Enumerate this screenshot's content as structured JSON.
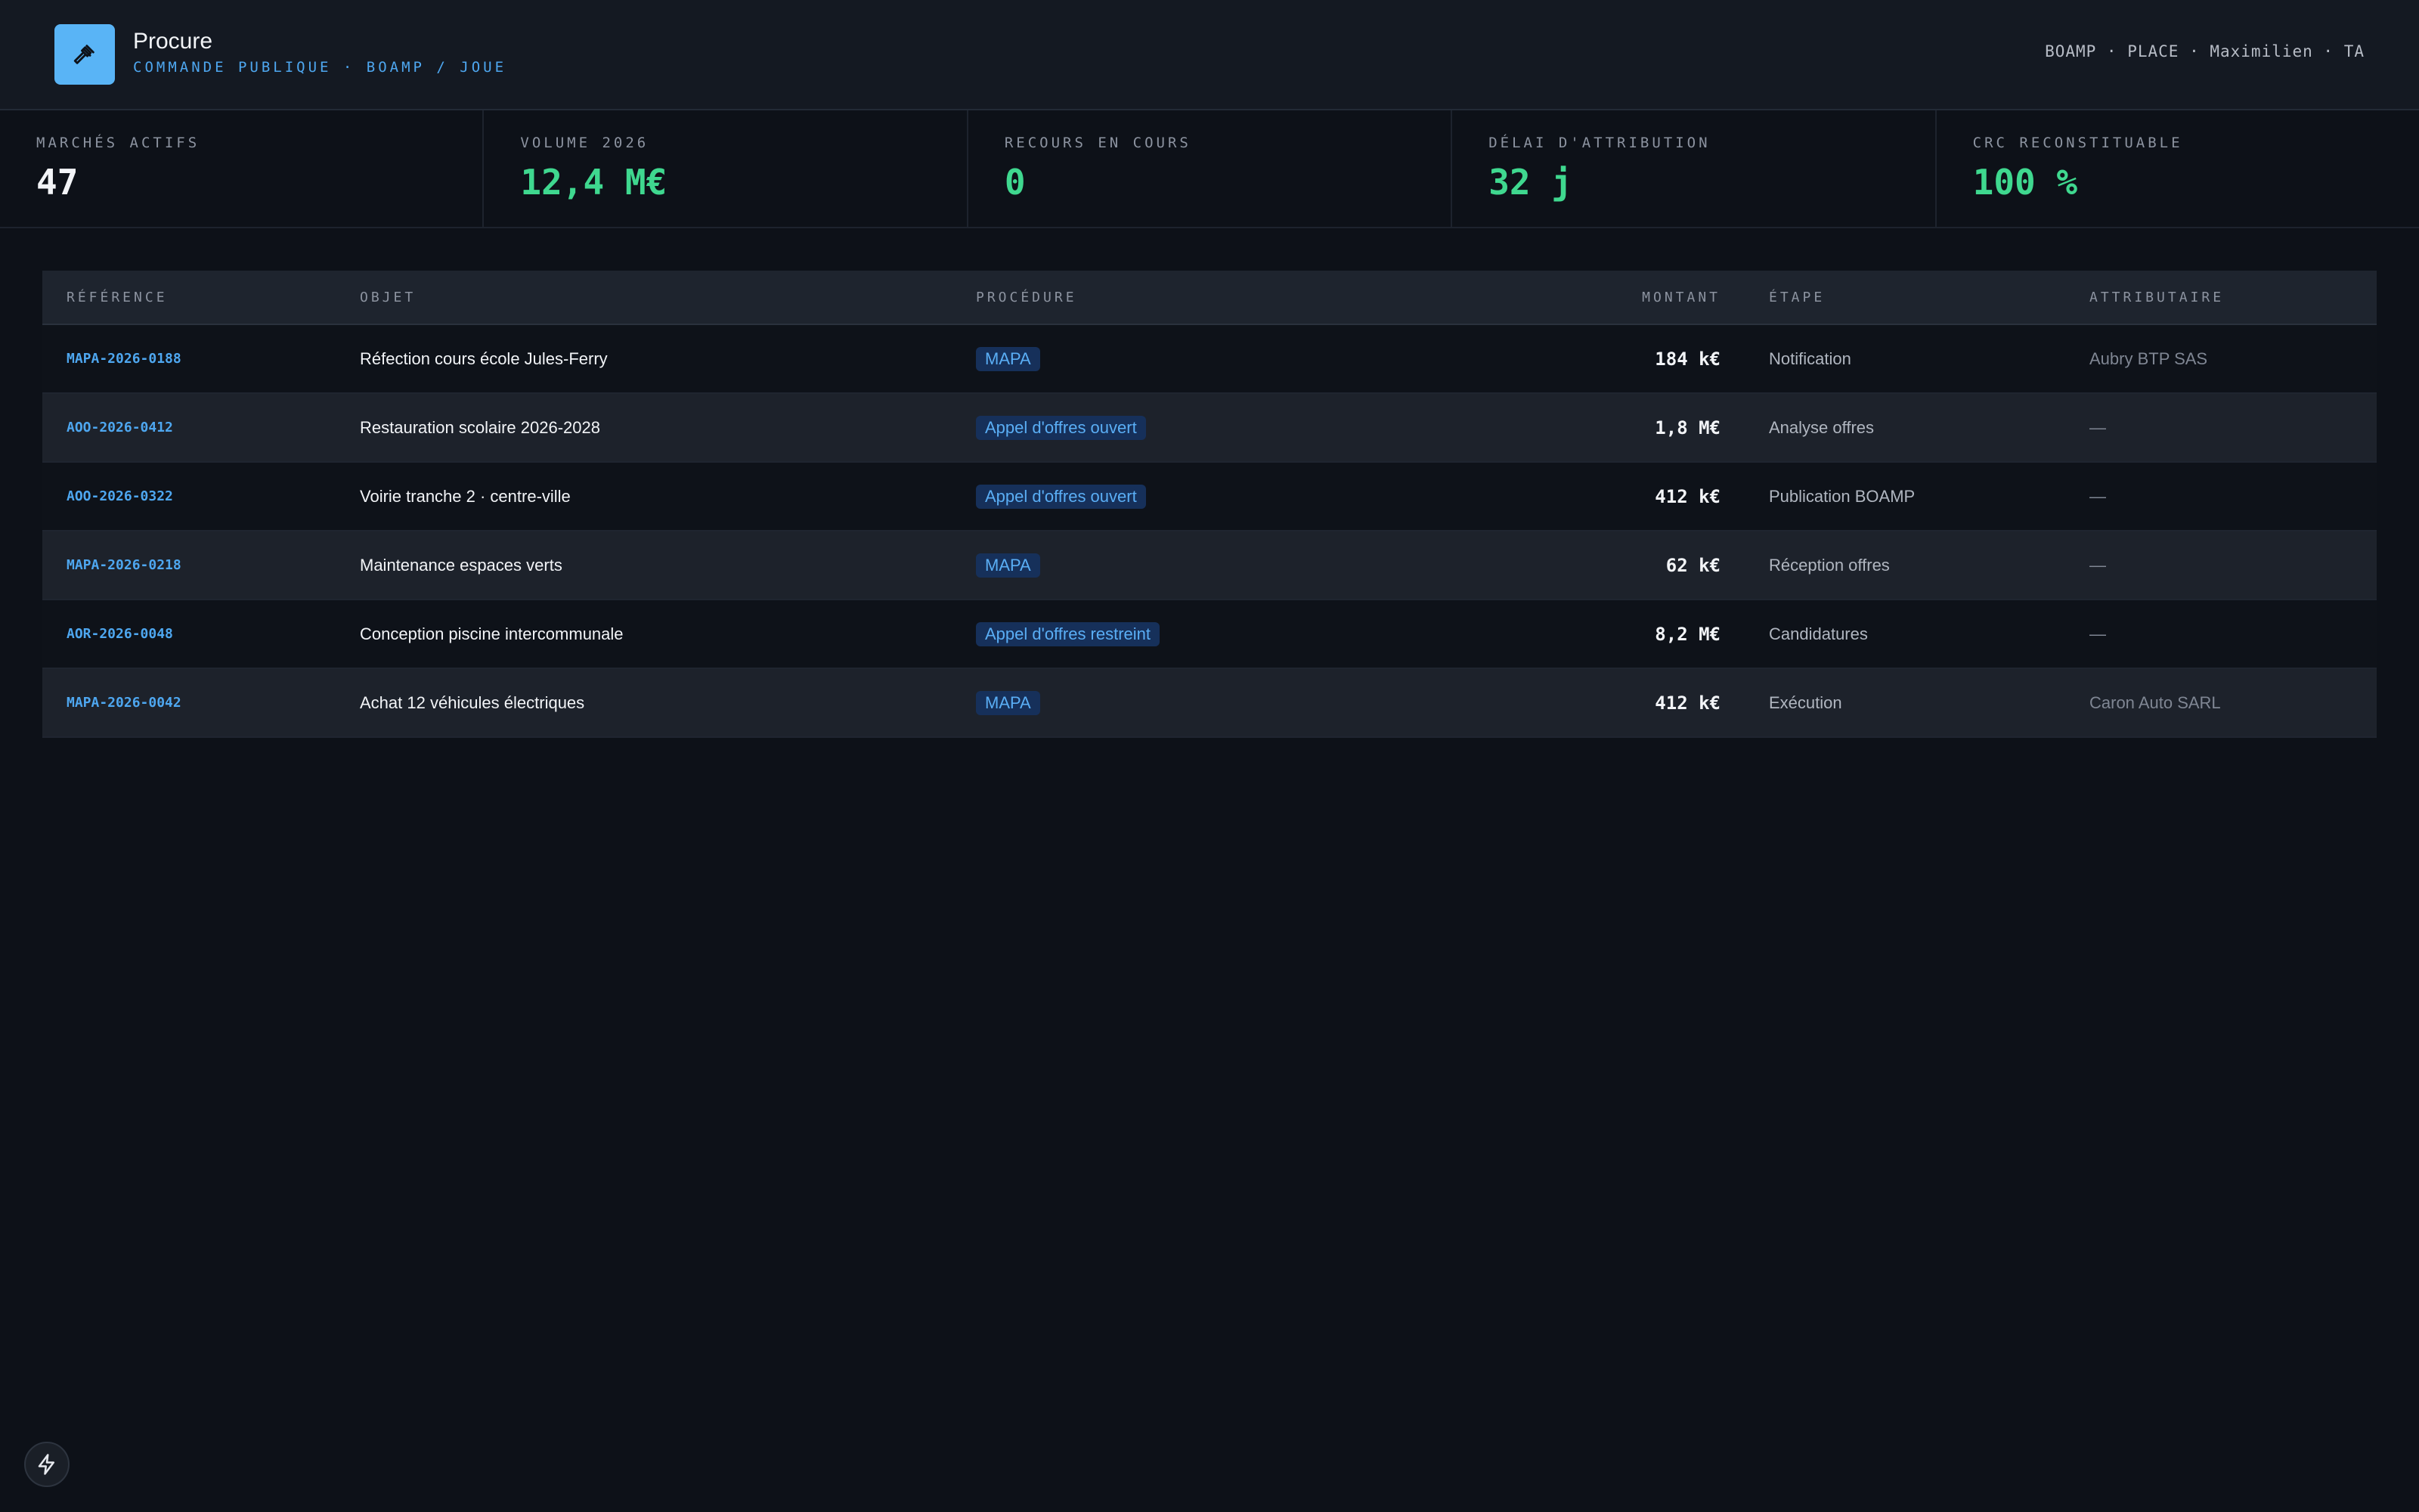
{
  "header": {
    "app_name": "Procure",
    "subtitle": "COMMANDE PUBLIQUE · BOAMP / JOUE",
    "user_info": "BOAMP · PLACE · Maximilien · TA",
    "logo_icon": "gavel-icon"
  },
  "stats": [
    {
      "label": "MARCHÉS ACTIFS",
      "value": "47",
      "color": "#f2f4f7"
    },
    {
      "label": "VOLUME 2026",
      "value": "12,4 M€",
      "color": "#3fd88f"
    },
    {
      "label": "RECOURS EN COURS",
      "value": "0",
      "color": "#3fd88f"
    },
    {
      "label": "DÉLAI D'ATTRIBUTION",
      "value": "32 j",
      "color": "#3fd88f"
    },
    {
      "label": "CRC RECONSTITUABLE",
      "value": "100 %",
      "color": "#3fd88f"
    }
  ],
  "table": {
    "columns": [
      "RÉFÉRENCE",
      "OBJET",
      "PROCÉDURE",
      "MONTANT",
      "ÉTAPE",
      "ATTRIBUTAIRE"
    ],
    "rows": [
      {
        "ref": "MAPA-2026-0188",
        "obj": "Réfection cours école Jules-Ferry",
        "proc": "MAPA",
        "amt": "184 k€",
        "step": "Notification",
        "attr": "Aubry BTP SAS"
      },
      {
        "ref": "AOO-2026-0412",
        "obj": "Restauration scolaire 2026-2028",
        "proc": "Appel d'offres ouvert",
        "amt": "1,8 M€",
        "step": "Analyse offres",
        "attr": "—"
      },
      {
        "ref": "AOO-2026-0322",
        "obj": "Voirie tranche 2 · centre-ville",
        "proc": "Appel d'offres ouvert",
        "amt": "412 k€",
        "step": "Publication BOAMP",
        "attr": "—"
      },
      {
        "ref": "MAPA-2026-0218",
        "obj": "Maintenance espaces verts",
        "proc": "MAPA",
        "amt": "62 k€",
        "step": "Réception offres",
        "attr": "—"
      },
      {
        "ref": "AOR-2026-0048",
        "obj": "Conception piscine intercommunale",
        "proc": "Appel d'offres restreint",
        "amt": "8,2 M€",
        "step": "Candidatures",
        "attr": "—"
      },
      {
        "ref": "MAPA-2026-0042",
        "obj": "Achat 12 véhicules électriques",
        "proc": "MAPA",
        "amt": "412 k€",
        "step": "Exécution",
        "attr": "Caron Auto SARL"
      }
    ]
  },
  "corner_button_icon": "lightning-icon"
}
